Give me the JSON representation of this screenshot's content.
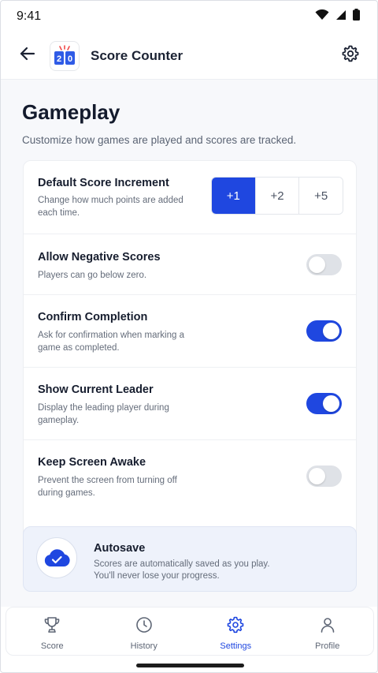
{
  "status_bar": {
    "time": "9:41"
  },
  "header": {
    "title": "Score Counter",
    "logo_left_digit": "2",
    "logo_right_digit": "0"
  },
  "page": {
    "title": "Gameplay",
    "subtitle": "Customize how games are played and scores are tracked."
  },
  "settings": {
    "increment": {
      "title": "Default Score Increment",
      "description": "Change how much points are added each time.",
      "options": [
        "+1",
        "+2",
        "+5"
      ],
      "selected": "+1"
    },
    "negative": {
      "title": "Allow Negative Scores",
      "description": "Players can go below zero.",
      "enabled": false
    },
    "confirm": {
      "title": "Confirm Completion",
      "description": "Ask for confirmation when marking a game as completed.",
      "enabled": true
    },
    "leader": {
      "title": "Show Current Leader",
      "description": "Display the leading player during gameplay.",
      "enabled": true
    },
    "awake": {
      "title": "Keep Screen Awake",
      "description": "Prevent the screen from turning off during games.",
      "enabled": false
    }
  },
  "autosave": {
    "title": "Autosave",
    "description": "Scores are automatically saved as you play. You'll never lose your progress."
  },
  "nav": {
    "items": [
      {
        "label": "Score",
        "icon": "trophy-icon"
      },
      {
        "label": "History",
        "icon": "clock-icon"
      },
      {
        "label": "Settings",
        "icon": "gear-icon"
      },
      {
        "label": "Profile",
        "icon": "user-icon"
      }
    ],
    "active": "Settings"
  },
  "colors": {
    "accent": "#1f47e0",
    "toggle_off": "#dfe2e7",
    "title": "#141b2d",
    "muted": "#646c7a"
  }
}
